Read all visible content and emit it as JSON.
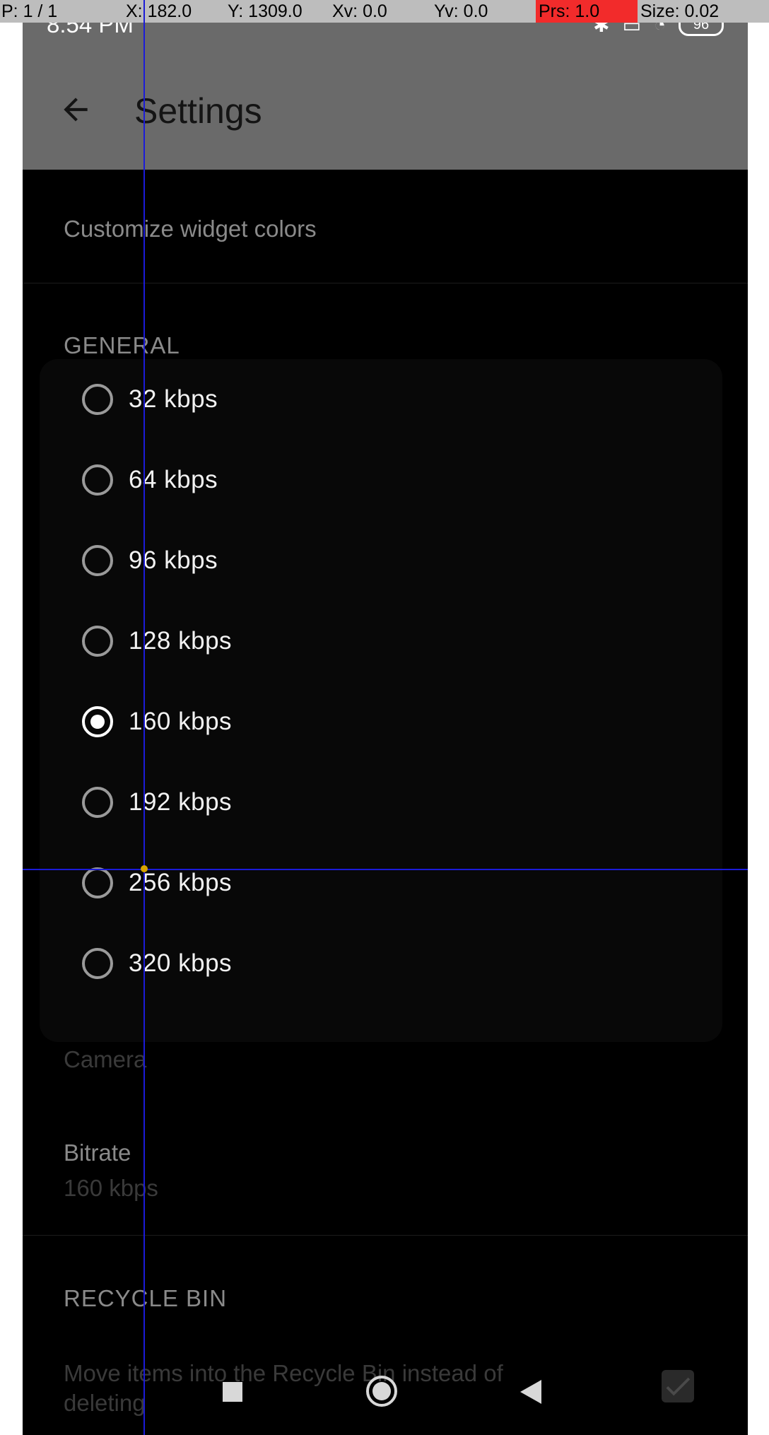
{
  "status_bar": {
    "time": "8:54 PM",
    "battery": "96"
  },
  "app_bar": {
    "title": "Settings"
  },
  "settings": {
    "customize_widget_colors": "Customize widget colors",
    "general_header": "GENERAL",
    "camera_label": "Camera",
    "bitrate_title": "Bitrate",
    "bitrate_value": "160 kbps",
    "recycle_header": "RECYCLE BIN",
    "recycle_line1": "Move items into the Recycle Bin instead of",
    "recycle_line2": "deleting"
  },
  "bitrate_dialog": {
    "options": [
      {
        "label": "32 kbps",
        "checked": false
      },
      {
        "label": "64 kbps",
        "checked": false
      },
      {
        "label": "96 kbps",
        "checked": false
      },
      {
        "label": "128 kbps",
        "checked": false
      },
      {
        "label": "160 kbps",
        "checked": true
      },
      {
        "label": "192 kbps",
        "checked": false
      },
      {
        "label": "256 kbps",
        "checked": false
      },
      {
        "label": "320 kbps",
        "checked": false
      }
    ]
  },
  "pointer_overlay": {
    "p": "P: 1 / 1",
    "x": "X: 182.0",
    "y": "Y: 1309.0",
    "xv": "Xv: 0.0",
    "yv": "Yv: 0.0",
    "prs": "Prs: 1.0",
    "size": "Size: 0.02"
  },
  "colors": {
    "accent": "#ffffff",
    "scrim": "#000000",
    "dialog": "#080808",
    "appbar": "#6a6a6a"
  }
}
